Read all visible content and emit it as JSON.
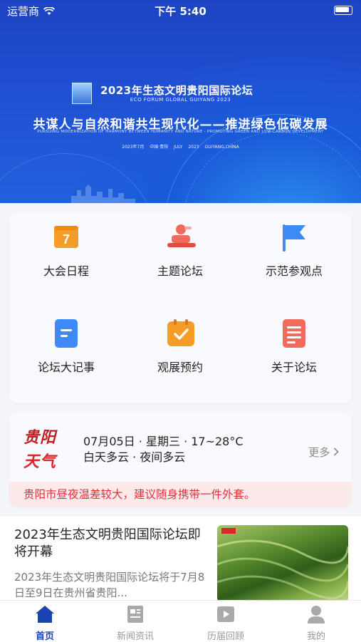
{
  "status_bar": {
    "carrier": "运营商",
    "time": "下午 5:40"
  },
  "banner": {
    "title": "2023年生态文明贵阳国际论坛",
    "title_en": "ECO FORUM GLOBAL GUIYANG 2023",
    "slogan": "共谋人与自然和谐共生现代化——推进绿色低碳发展",
    "slogan_en": "PURSUING MODERNIZATION OF HARMONY BETWEEN HUMANITY AND NATURE - PROMOTING GREEN AND LOW-CARBON DEVELOPMENT",
    "dates": "2023年7月 中国·贵阳 JULY 2023 GUIYANG,CHINA"
  },
  "menu": {
    "items": [
      {
        "label": "大会日程",
        "icon": "calendar-icon",
        "badge": "7"
      },
      {
        "label": "主题论坛",
        "icon": "speaker-icon"
      },
      {
        "label": "示范参观点",
        "icon": "flag-icon"
      },
      {
        "label": "论坛大记事",
        "icon": "notes-icon"
      },
      {
        "label": "观展预约",
        "icon": "checklist-icon"
      },
      {
        "label": "关于论坛",
        "icon": "document-icon"
      }
    ]
  },
  "weather": {
    "logo_line1": "贵阳",
    "logo_line2": "天气",
    "date_line": "07月05日 · 星期三 · 17~28°C",
    "condition": "白天多云 · 夜间多云",
    "more": "更多",
    "tip": "贵阳市昼夜温差较大，建议随身携带一件外套。"
  },
  "news": {
    "title": "2023年生态文明贵阳国际论坛即将开幕",
    "summary": "2023年生态文明贵阳国际论坛将于7月8日至9日在贵州省贵阳..."
  },
  "tabbar": {
    "tabs": [
      {
        "label": "首页",
        "icon": "home-icon"
      },
      {
        "label": "新闻资讯",
        "icon": "newspaper-icon"
      },
      {
        "label": "历届回顾",
        "icon": "video-icon"
      },
      {
        "label": "我的",
        "icon": "profile-icon"
      }
    ],
    "active_index": 0
  },
  "colors": {
    "brand": "#1b44b3",
    "accent_red": "#e0313a",
    "orange": "#f59b27",
    "blue": "#3d8af7"
  }
}
